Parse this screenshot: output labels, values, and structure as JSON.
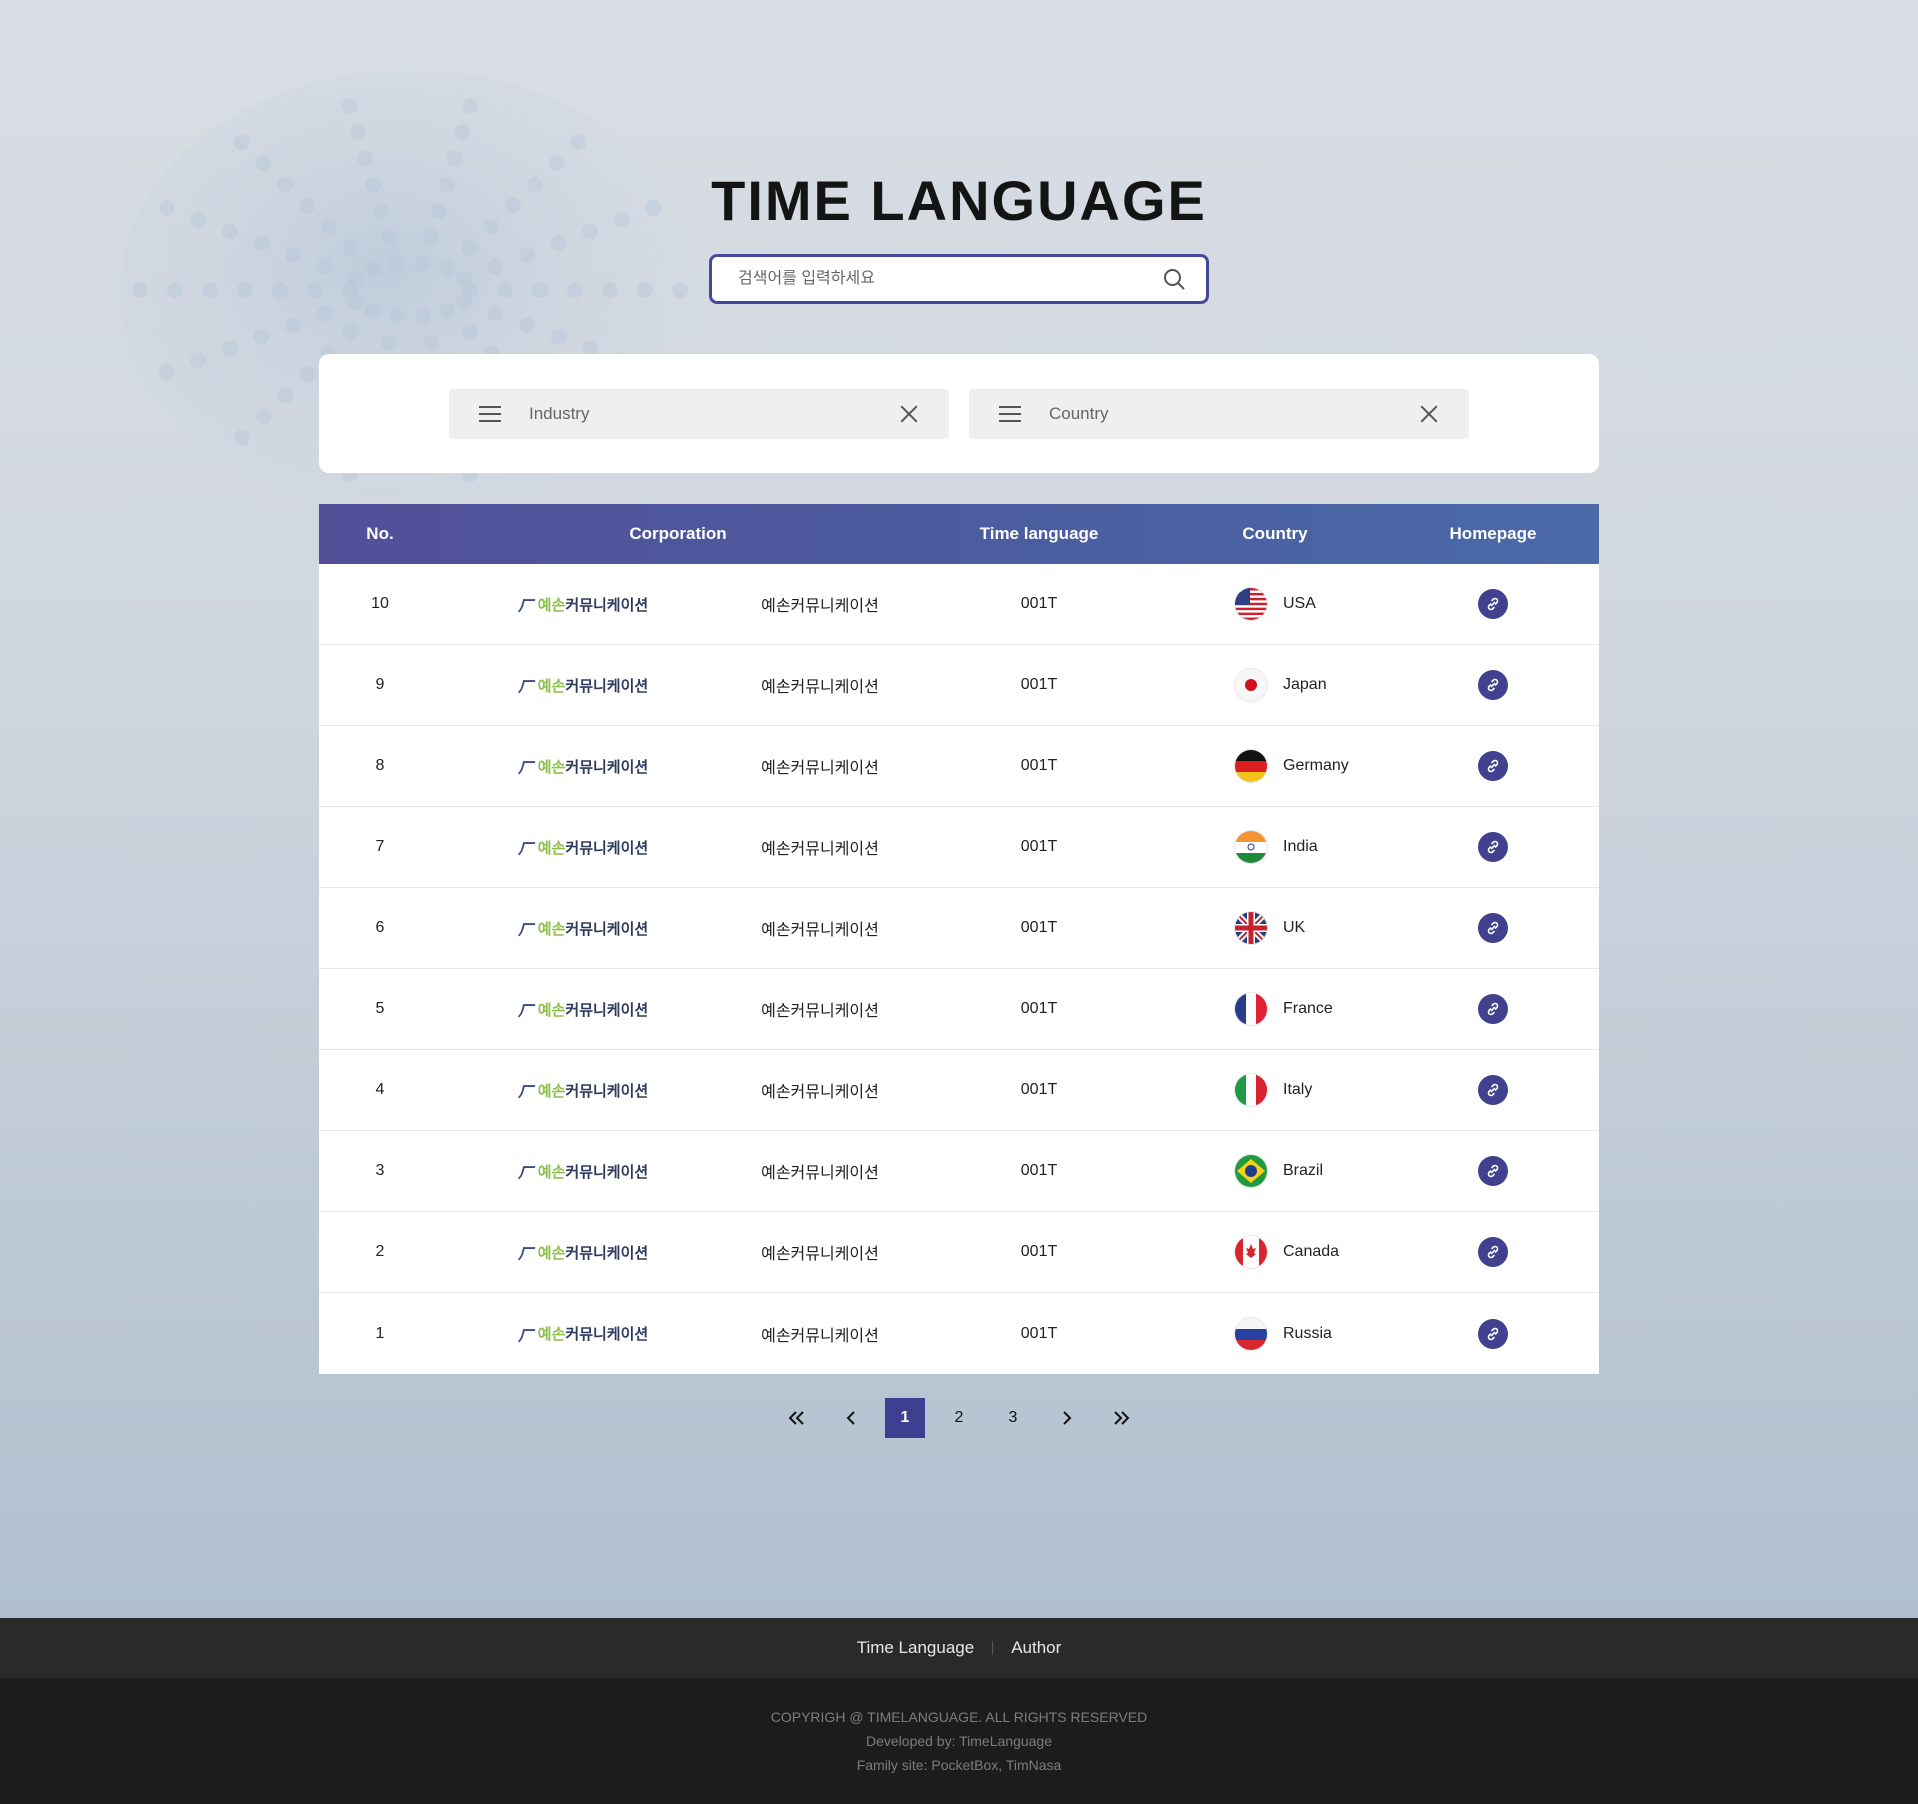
{
  "header": {
    "title": "TIME LANGUAGE",
    "search_placeholder": "검색어를 입력하세요"
  },
  "filters": {
    "industry_label": "Industry",
    "country_label": "Country"
  },
  "table": {
    "columns": {
      "no": "No.",
      "corporation": "Corporation",
      "time_language": "Time language",
      "country": "Country",
      "homepage": "Homepage"
    },
    "logo_text": {
      "green": "예손",
      "dark": "커뮤니케이션"
    },
    "rows": [
      {
        "no": "10",
        "corp_name": "예손커뮤니케이션",
        "time_language": "001T",
        "country": "USA",
        "flag": "usa-flag"
      },
      {
        "no": "9",
        "corp_name": "예손커뮤니케이션",
        "time_language": "001T",
        "country": "Japan",
        "flag": "japan-flag"
      },
      {
        "no": "8",
        "corp_name": "예손커뮤니케이션",
        "time_language": "001T",
        "country": "Germany",
        "flag": "germany-flag"
      },
      {
        "no": "7",
        "corp_name": "예손커뮤니케이션",
        "time_language": "001T",
        "country": "India",
        "flag": "india-flag"
      },
      {
        "no": "6",
        "corp_name": "예손커뮤니케이션",
        "time_language": "001T",
        "country": "UK",
        "flag": "uk-flag"
      },
      {
        "no": "5",
        "corp_name": "예손커뮤니케이션",
        "time_language": "001T",
        "country": "France",
        "flag": "france-flag"
      },
      {
        "no": "4",
        "corp_name": "예손커뮤니케이션",
        "time_language": "001T",
        "country": "Italy",
        "flag": "italy-flag"
      },
      {
        "no": "3",
        "corp_name": "예손커뮤니케이션",
        "time_language": "001T",
        "country": "Brazil",
        "flag": "brazil-flag"
      },
      {
        "no": "2",
        "corp_name": "예손커뮤니케이션",
        "time_language": "001T",
        "country": "Canada",
        "flag": "canada-flag"
      },
      {
        "no": "1",
        "corp_name": "예손커뮤니케이션",
        "time_language": "001T",
        "country": "Russia",
        "flag": "russia-flag"
      }
    ]
  },
  "pagination": {
    "pages": [
      "1",
      "2",
      "3"
    ],
    "current": "1"
  },
  "footer": {
    "links": [
      "Time Language",
      "Author"
    ],
    "copyright": "COPYRIGH @ TIMELANGUAGE. ALL RIGHTS RESERVED",
    "developed_by": "Developed by: TimeLanguage",
    "family_site": "Family site: PocketBox, TimNasa"
  },
  "colors": {
    "accent": "#41418f",
    "header_gradient_start": "#524f98",
    "header_gradient_end": "#4a6aa8",
    "logo_green": "#8cc04a"
  }
}
